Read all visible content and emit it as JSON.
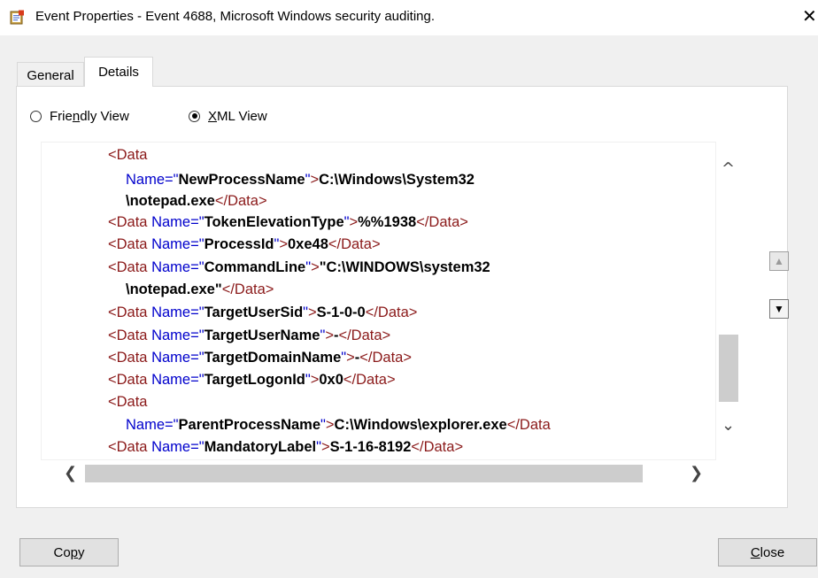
{
  "window": {
    "title": "Event Properties - Event 4688, Microsoft Windows security auditing.",
    "close_glyph": "✕"
  },
  "tabs": [
    {
      "label": "General",
      "active": false
    },
    {
      "label": "Details",
      "active": true
    }
  ],
  "view_options": [
    {
      "label_pre": "Frie",
      "mnemonic": "n",
      "label_post": "dly View",
      "selected": false
    },
    {
      "label_pre": "",
      "mnemonic": "X",
      "label_post": "ML View",
      "selected": true
    }
  ],
  "xml": {
    "lines": [
      {
        "type": "open_only"
      },
      {
        "type": "name_value_wrapped",
        "name": "NewProcessName",
        "value": "C:\\Windows\\System32"
      },
      {
        "type": "continuation",
        "value": "\\notepad.exe"
      },
      {
        "type": "pair",
        "name": "TokenElevationType",
        "value": "%%1938"
      },
      {
        "type": "pair",
        "name": "ProcessId",
        "value": "0xe48"
      },
      {
        "type": "pair_open",
        "name": "CommandLine",
        "value": "\"C:\\WINDOWS\\system32"
      },
      {
        "type": "continuation",
        "value": "\\notepad.exe\""
      },
      {
        "type": "pair",
        "name": "TargetUserSid",
        "value": "S-1-0-0"
      },
      {
        "type": "pair",
        "name": "TargetUserName",
        "value": "-"
      },
      {
        "type": "pair",
        "name": "TargetDomainName",
        "value": "-"
      },
      {
        "type": "pair",
        "name": "TargetLogonId",
        "value": "0x0"
      },
      {
        "type": "open_only"
      },
      {
        "type": "name_value_clipped",
        "name": "ParentProcessName",
        "value": "C:\\Windows\\explorer.exe",
        "close_clipped": "</Data"
      },
      {
        "type": "pair",
        "name": "MandatoryLabel",
        "value": "S-1-16-8192"
      }
    ],
    "tag_open": "<Data",
    "tag_close": "</Data>",
    "attr_name": "Name=",
    "attr_indent_name": "Name="
  },
  "buttons": {
    "copy_pre": "Co",
    "copy_mnemonic": "p",
    "copy_post": "y",
    "close_pre": "",
    "close_mnemonic": "C",
    "close_post": "lose"
  },
  "icons": {
    "app": "event-viewer-icon",
    "scroll_up": "^",
    "scroll_down": "⌄",
    "scroll_left": "❮",
    "scroll_right": "❯",
    "nav_up": "▲",
    "nav_down": "▼"
  }
}
